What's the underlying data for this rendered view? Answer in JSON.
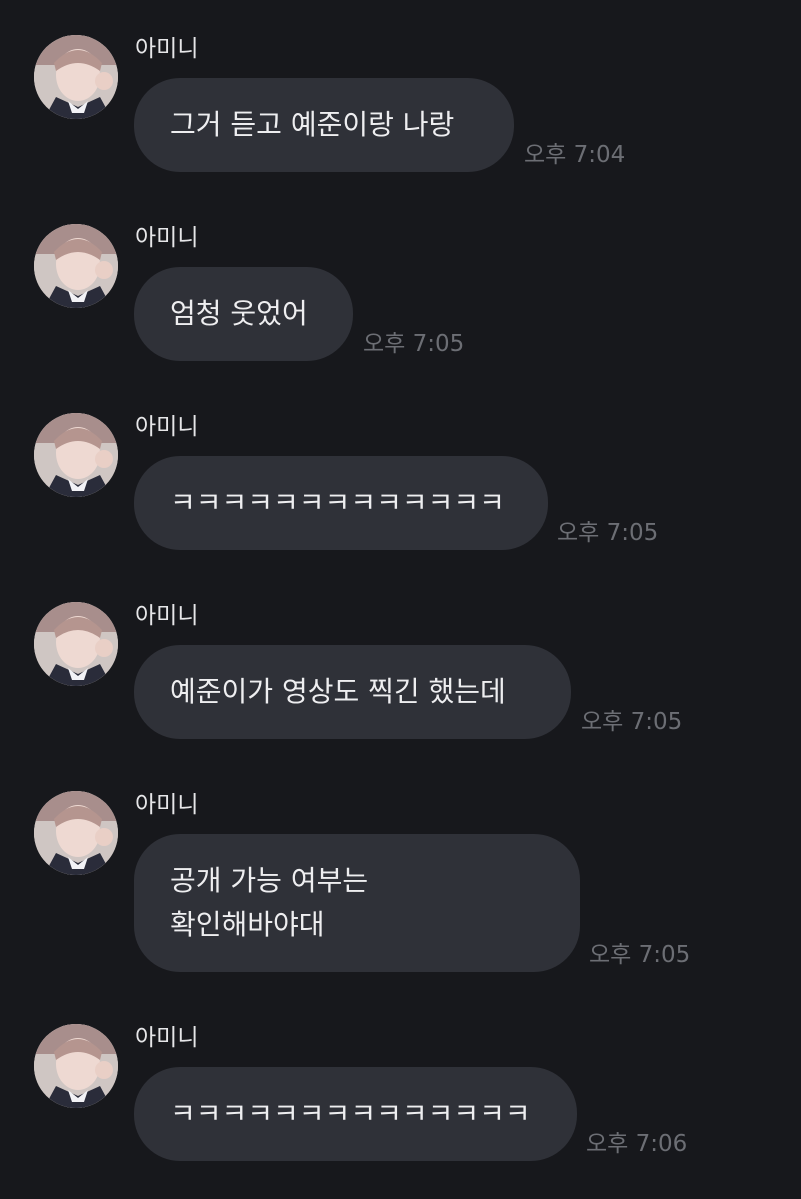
{
  "messages": [
    {
      "sender": "아미니",
      "text": "그거 듣고 예준이랑 나랑",
      "time": "오후 7:04",
      "avatar_icon": "profile-photo"
    },
    {
      "sender": "아미니",
      "text": "엄청 웃었어",
      "time": "오후 7:05",
      "avatar_icon": "profile-photo"
    },
    {
      "sender": "아미니",
      "text": "ㅋㅋㅋㅋㅋㅋㅋㅋㅋㅋㅋㅋㅋ",
      "time": "오후 7:05",
      "avatar_icon": "profile-photo"
    },
    {
      "sender": "아미니",
      "text": "예준이가 영상도 찍긴 했는데",
      "time": "오후 7:05",
      "avatar_icon": "profile-photo"
    },
    {
      "sender": "아미니",
      "text": "공개 가능 여부는\n확인해바야대",
      "time": "오후 7:05",
      "avatar_icon": "profile-photo"
    },
    {
      "sender": "아미니",
      "text": "ㅋㅋㅋㅋㅋㅋㅋㅋㅋㅋㅋㅋㅋㅋ",
      "time": "오후 7:06",
      "avatar_icon": "profile-photo"
    }
  ],
  "colors": {
    "background": "#17181c",
    "bubble": "#2f3138",
    "text": "#eeeef0",
    "time": "#6c6e74"
  }
}
